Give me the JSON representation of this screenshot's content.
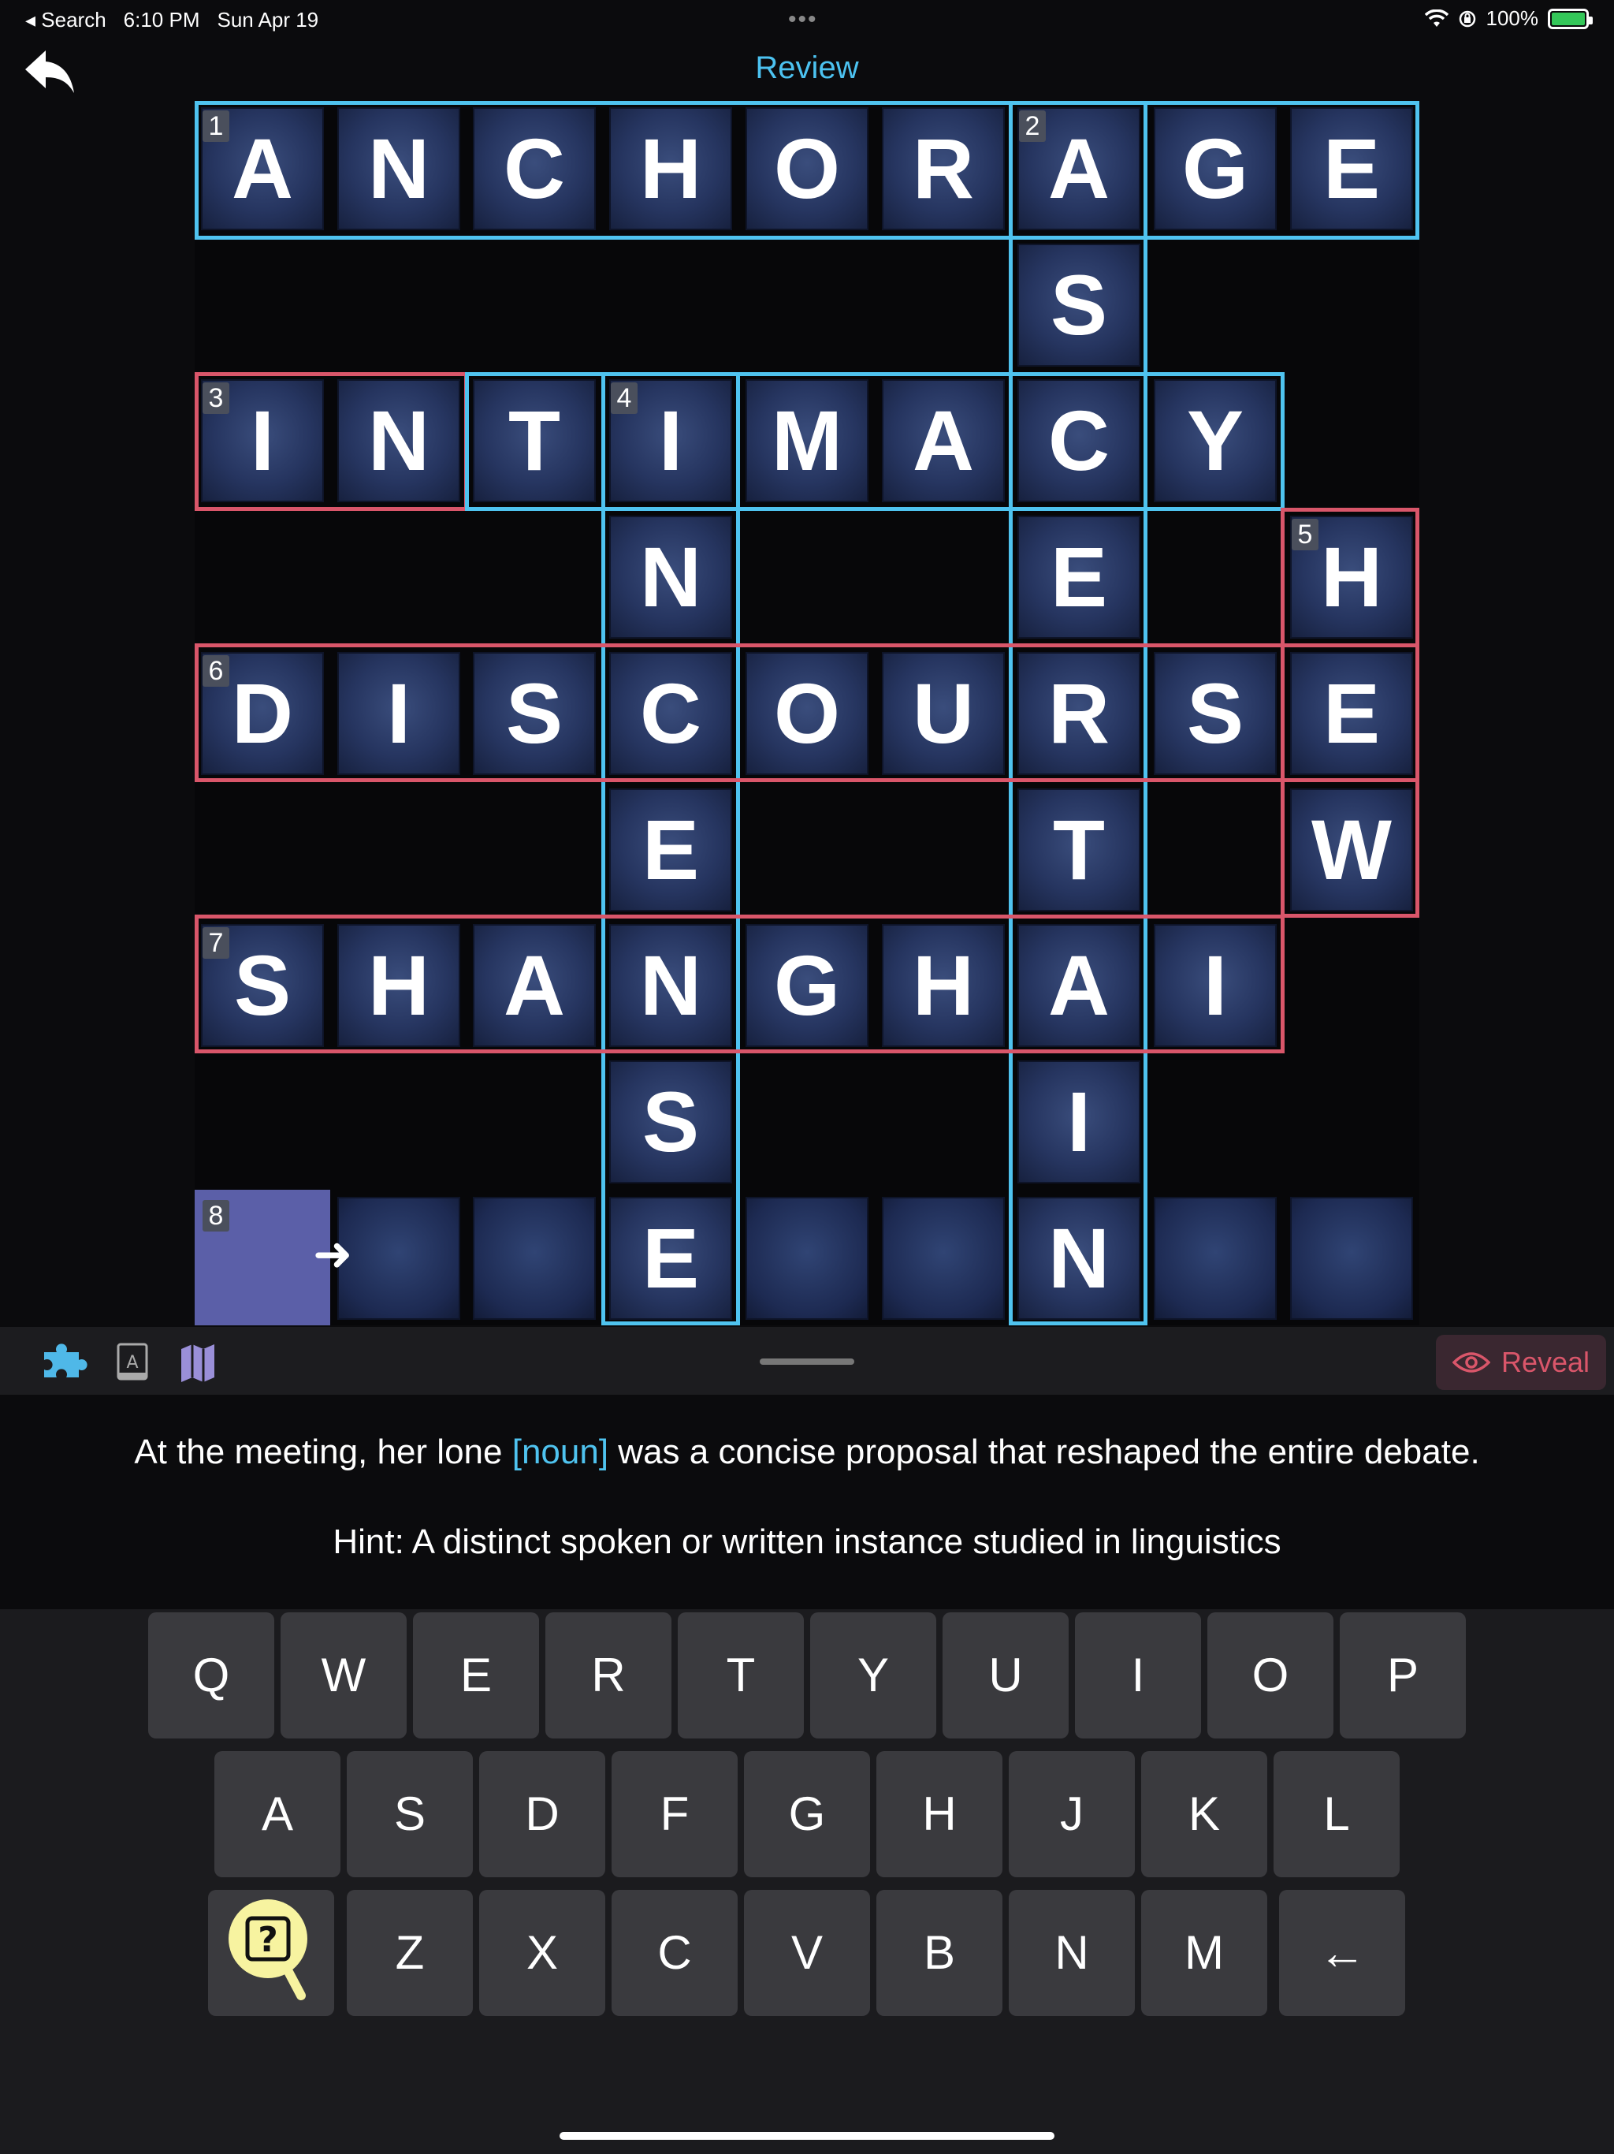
{
  "status": {
    "back_app": "◂ Search",
    "time": "6:10 PM",
    "date": "Sun Apr 19",
    "dots": "•••",
    "battery": "100%"
  },
  "header": {
    "title": "Review"
  },
  "board": {
    "rows": [
      [
        "A",
        "N",
        "C",
        "H",
        "O",
        "R",
        "A",
        "G",
        "E"
      ],
      [
        "",
        "",
        "",
        "",
        "",
        "",
        "S",
        "",
        ""
      ],
      [
        "I",
        "N",
        "T",
        "I",
        "M",
        "A",
        "C",
        "Y",
        ""
      ],
      [
        "",
        "",
        "",
        "N",
        "",
        "",
        "E",
        "",
        "H"
      ],
      [
        "D",
        "I",
        "S",
        "C",
        "O",
        "U",
        "R",
        "S",
        "E"
      ],
      [
        "",
        "",
        "",
        "E",
        "",
        "",
        "T",
        "",
        "W"
      ],
      [
        "S",
        "H",
        "A",
        "N",
        "G",
        "H",
        "A",
        "I",
        ""
      ],
      [
        "",
        "",
        "",
        "S",
        "",
        "",
        "I",
        "",
        ""
      ],
      [
        "",
        "",
        "",
        "E",
        "",
        "",
        "N",
        "",
        ""
      ]
    ],
    "numbers": [
      {
        "label": "1",
        "row": 0,
        "col": 0
      },
      {
        "label": "2",
        "row": 0,
        "col": 6
      },
      {
        "label": "3",
        "row": 2,
        "col": 0
      },
      {
        "label": "4",
        "row": 2,
        "col": 3
      },
      {
        "label": "5",
        "row": 3,
        "col": 8
      },
      {
        "label": "6",
        "row": 4,
        "col": 0
      },
      {
        "label": "7",
        "row": 6,
        "col": 0
      },
      {
        "label": "8",
        "row": 8,
        "col": 0
      }
    ],
    "colors": {
      "solved": "#4fc3ef",
      "incorrect": "#d9566a",
      "active": "#5b5fa8"
    }
  },
  "toolbar": {
    "icons": [
      "puzzle-icon",
      "dictionary-icon",
      "map-icon"
    ],
    "reveal_label": "Reveal"
  },
  "clue": {
    "before": "At the meeting, her lone ",
    "highlight": "[noun]",
    "after": " was a concise proposal that reshaped the entire debate.",
    "hint": "Hint: A distinct spoken or written instance studied in linguistics"
  },
  "keyboard": {
    "row1": [
      "Q",
      "W",
      "E",
      "R",
      "T",
      "Y",
      "U",
      "I",
      "O",
      "P"
    ],
    "row2": [
      "A",
      "S",
      "D",
      "F",
      "G",
      "H",
      "J",
      "K",
      "L"
    ],
    "row3": [
      "Z",
      "X",
      "C",
      "V",
      "B",
      "N",
      "M"
    ],
    "backspace": "←"
  }
}
